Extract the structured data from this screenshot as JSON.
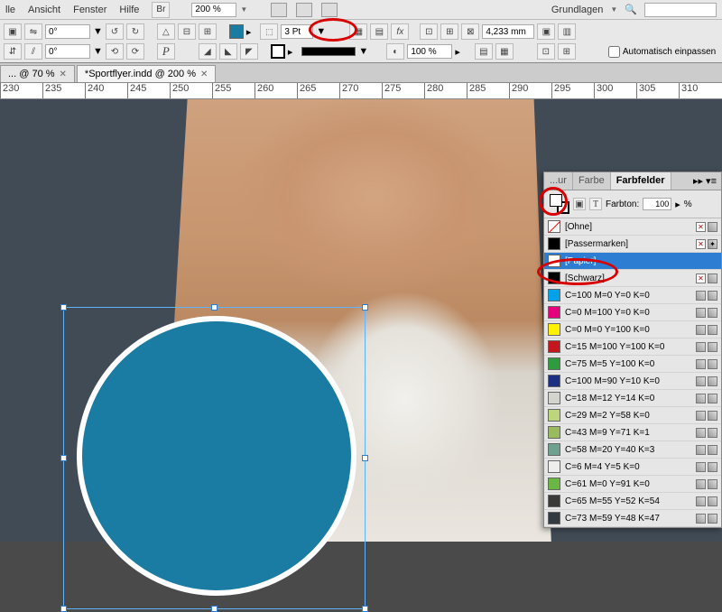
{
  "menu": {
    "items": [
      "lle",
      "Ansicht",
      "Fenster",
      "Hilfe"
    ],
    "zoom": "200 %",
    "workspace": "Grundlagen"
  },
  "control": {
    "angle1": "0°",
    "angle2": "0°",
    "stroke_weight": "3 Pt",
    "width_field": "4,233 mm",
    "opacity": "100 %",
    "autofit": "Automatisch einpassen"
  },
  "tabs": [
    {
      "label": "... @ 70 %"
    },
    {
      "label": "*Sportflyer.indd @ 200 %"
    }
  ],
  "ruler_marks": [
    "230",
    "235",
    "240",
    "245",
    "250",
    "255",
    "260",
    "265",
    "270",
    "275",
    "280",
    "285",
    "290",
    "295",
    "300",
    "305",
    "310"
  ],
  "panel": {
    "tabs": [
      "...ur",
      "Farbe",
      "Farbfelder"
    ],
    "tint_label": "Farbton:",
    "tint_value": "100",
    "tint_unit": "%",
    "swatches": [
      {
        "name": "[Ohne]",
        "color": "none",
        "icons": [
          "x",
          "g"
        ]
      },
      {
        "name": "[Passermarken]",
        "color": "#000",
        "icons": [
          "x",
          "reg"
        ]
      },
      {
        "name": "[Papier]",
        "color": "#fff",
        "selected": true,
        "icons": []
      },
      {
        "name": "[Schwarz]",
        "color": "#000",
        "icons": [
          "x",
          "g"
        ]
      },
      {
        "name": "C=100 M=0 Y=0 K=0",
        "color": "#00a3e8",
        "icons": [
          "g",
          "g"
        ]
      },
      {
        "name": "C=0 M=100 Y=0 K=0",
        "color": "#e6007e",
        "icons": [
          "g",
          "g"
        ]
      },
      {
        "name": "C=0 M=0 Y=100 K=0",
        "color": "#fff200",
        "icons": [
          "g",
          "g"
        ]
      },
      {
        "name": "C=15 M=100 Y=100 K=0",
        "color": "#c4161c",
        "icons": [
          "g",
          "g"
        ]
      },
      {
        "name": "C=75 M=5 Y=100 K=0",
        "color": "#2e9b3e",
        "icons": [
          "g",
          "g"
        ]
      },
      {
        "name": "C=100 M=90 Y=10 K=0",
        "color": "#1c2f82",
        "icons": [
          "g",
          "g"
        ]
      },
      {
        "name": "C=18 M=12 Y=14 K=0",
        "color": "#d4d4ce",
        "icons": [
          "g",
          "g"
        ]
      },
      {
        "name": "C=29 M=2 Y=58 K=0",
        "color": "#bdd67c",
        "icons": [
          "g",
          "g"
        ]
      },
      {
        "name": "C=43 M=9 Y=71 K=1",
        "color": "#99bb5d",
        "icons": [
          "g",
          "g"
        ]
      },
      {
        "name": "C=58 M=20 Y=40 K=3",
        "color": "#6fa191",
        "icons": [
          "g",
          "g"
        ]
      },
      {
        "name": "C=6 M=4 Y=5 K=0",
        "color": "#eeeeec",
        "icons": [
          "g",
          "g"
        ]
      },
      {
        "name": "C=61 M=0 Y=91 K=0",
        "color": "#6bb745",
        "icons": [
          "g",
          "g"
        ]
      },
      {
        "name": "C=65 M=55 Y=52 K=54",
        "color": "#3a3a38",
        "icons": [
          "g",
          "g"
        ]
      },
      {
        "name": "C=73 M=59 Y=48 K=47",
        "color": "#333a40",
        "icons": [
          "g",
          "g"
        ]
      }
    ]
  },
  "chart_data": null
}
